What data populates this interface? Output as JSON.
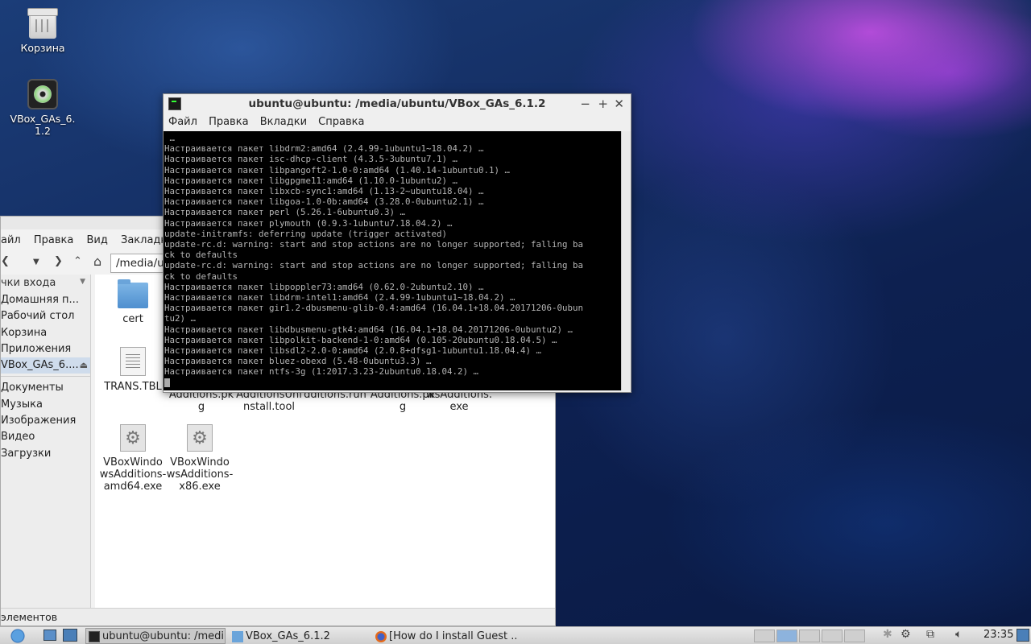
{
  "desktop": {
    "icons": [
      {
        "label": "Корзина",
        "icon": "trash-icon"
      },
      {
        "label": "VBox_GAs_6.1.2",
        "icon": "disc-icon"
      }
    ]
  },
  "file_manager": {
    "menu": [
      "айл",
      "Правка",
      "Вид",
      "Закладки"
    ],
    "path": "/media/ub",
    "sidebar_header": "чки входа",
    "sidebar_items": [
      "Домашняя п...",
      "Рабочий стол",
      "Корзина",
      "Приложения",
      "VBox_GAs_6...."
    ],
    "sidebar_items2": [
      "Документы",
      "Музыка",
      "Изображения",
      "Видео",
      "Загрузки"
    ],
    "files_row1": [
      "cert"
    ],
    "files_row2": [
      "TRANS.TBL"
    ],
    "files_partial": [
      "Additions.pkg",
      "AdditionsUninstall.tool",
      "dditions.run",
      "Additions.pkg",
      "wsAdditions.exe"
    ],
    "files_row3": [
      "VBoxWindowsAdditions-amd64.exe",
      "VBoxWindowsAdditions-x86.exe"
    ],
    "status": "элементов"
  },
  "terminal": {
    "title": "ubuntu@ubuntu: /media/ubuntu/VBox_GAs_6.1.2",
    "menu": [
      "Файл",
      "Правка",
      "Вкладки",
      "Справка"
    ],
    "lines": [
      " …",
      "Настраивается пакет libdrm2:amd64 (2.4.99-1ubuntu1~18.04.2) …",
      "Настраивается пакет isc-dhcp-client (4.3.5-3ubuntu7.1) …",
      "Настраивается пакет libpangoft2-1.0-0:amd64 (1.40.14-1ubuntu0.1) …",
      "Настраивается пакет libgpgme11:amd64 (1.10.0-1ubuntu2) …",
      "Настраивается пакет libxcb-sync1:amd64 (1.13-2~ubuntu18.04) …",
      "Настраивается пакет libgoa-1.0-0b:amd64 (3.28.0-0ubuntu2.1) …",
      "Настраивается пакет perl (5.26.1-6ubuntu0.3) …",
      "Настраивается пакет plymouth (0.9.3-1ubuntu7.18.04.2) …",
      "update-initramfs: deferring update (trigger activated)",
      "update-rc.d: warning: start and stop actions are no longer supported; falling ba",
      "ck to defaults",
      "update-rc.d: warning: start and stop actions are no longer supported; falling ba",
      "ck to defaults",
      "Настраивается пакет libpoppler73:amd64 (0.62.0-2ubuntu2.10) …",
      "Настраивается пакет libdrm-intel1:amd64 (2.4.99-1ubuntu1~18.04.2) …",
      "Настраивается пакет gir1.2-dbusmenu-glib-0.4:amd64 (16.04.1+18.04.20171206-0ubun",
      "tu2) …",
      "Настраивается пакет libdbusmenu-gtk4:amd64 (16.04.1+18.04.20171206-0ubuntu2) …",
      "Настраивается пакет libpolkit-backend-1-0:amd64 (0.105-20ubuntu0.18.04.5) …",
      "Настраивается пакет libsdl2-2.0-0:amd64 (2.0.8+dfsg1-1ubuntu1.18.04.4) …",
      "Настраивается пакет bluez-obexd (5.48-0ubuntu3.3) …",
      "Настраивается пакет ntfs-3g (1:2017.3.23-2ubuntu0.18.04.2) …"
    ]
  },
  "taskbar": {
    "tasks": [
      "ubuntu@ubuntu: /medi...",
      "VBox_GAs_6.1.2",
      "[How do I install Guest ..."
    ],
    "clock": "23:35"
  }
}
